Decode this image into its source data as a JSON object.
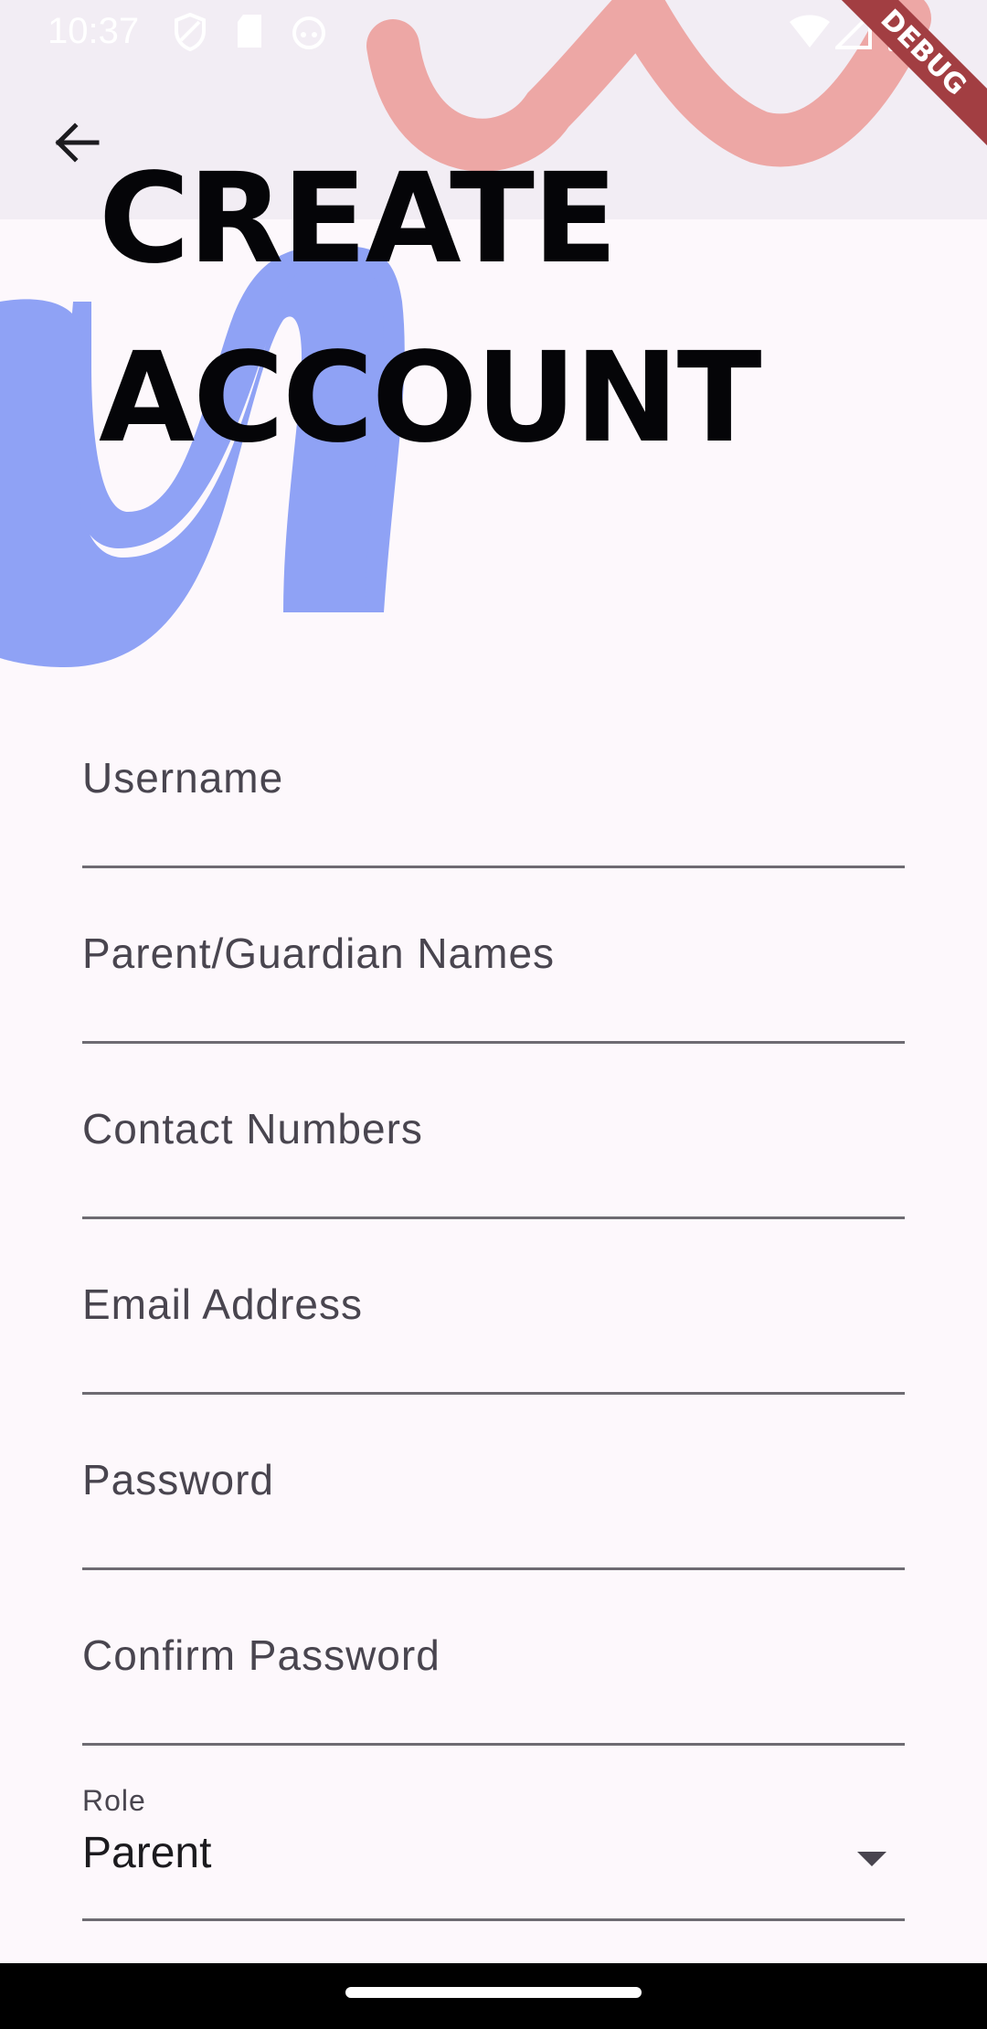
{
  "status_bar": {
    "time": "10:37",
    "icons": [
      "shield-icon",
      "sd-card-icon",
      "android-face-icon",
      "wifi-icon",
      "signal-icon",
      "battery-icon"
    ]
  },
  "header": {
    "back_icon": "arrow-back-icon",
    "title_line1": "CREATE",
    "title_line2": "ACCOUNT"
  },
  "debug_banner": "DEBUG",
  "form": {
    "username": {
      "label": "Username",
      "value": ""
    },
    "parent_names": {
      "label": "Parent/Guardian Names",
      "value": ""
    },
    "contact_numbers": {
      "label": "Contact Numbers",
      "value": ""
    },
    "email": {
      "label": "Email Address",
      "value": ""
    },
    "password": {
      "label": "Password",
      "value": ""
    },
    "confirm_password": {
      "label": "Confirm Password",
      "value": ""
    },
    "role": {
      "label": "Role",
      "value": "Parent"
    }
  },
  "colors": {
    "background": "#fdf8fc",
    "appbar": "#f2edf4",
    "pink_squiggle": "#eda7a5",
    "blue_squiggle": "#8fa2f5",
    "debug_banner": "#a23e42"
  }
}
